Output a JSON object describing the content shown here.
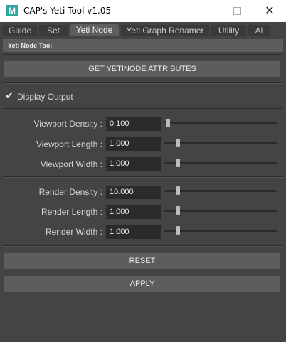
{
  "window": {
    "title": "CAP's Yeti Tool v1.05",
    "app_icon_letter": "M"
  },
  "tabs": [
    {
      "label": "Guide"
    },
    {
      "label": "Set"
    },
    {
      "label": "Yeti Node"
    },
    {
      "label": "Yeti Graph Renamer"
    },
    {
      "label": "Utility"
    },
    {
      "label": "Al"
    }
  ],
  "section": {
    "title": "Yeti Node Tool"
  },
  "buttons": {
    "get_attributes": "GET YETINODE ATTRIBUTES",
    "reset": "RESET",
    "apply": "APPLY"
  },
  "display_output": {
    "label": "Display Output",
    "checked": true
  },
  "viewport": [
    {
      "label": "Viewport Density :",
      "value": "0.100",
      "slider": 0.0
    },
    {
      "label": "Viewport Length :",
      "value": "1.000",
      "slider": 0.1
    },
    {
      "label": "Viewport Width :",
      "value": "1.000",
      "slider": 0.1
    }
  ],
  "render": [
    {
      "label": "Render Density :",
      "value": "10.000",
      "slider": 0.1
    },
    {
      "label": "Render Length :",
      "value": "1.000",
      "slider": 0.1
    },
    {
      "label": "Render Width :",
      "value": "1.000",
      "slider": 0.1
    }
  ]
}
